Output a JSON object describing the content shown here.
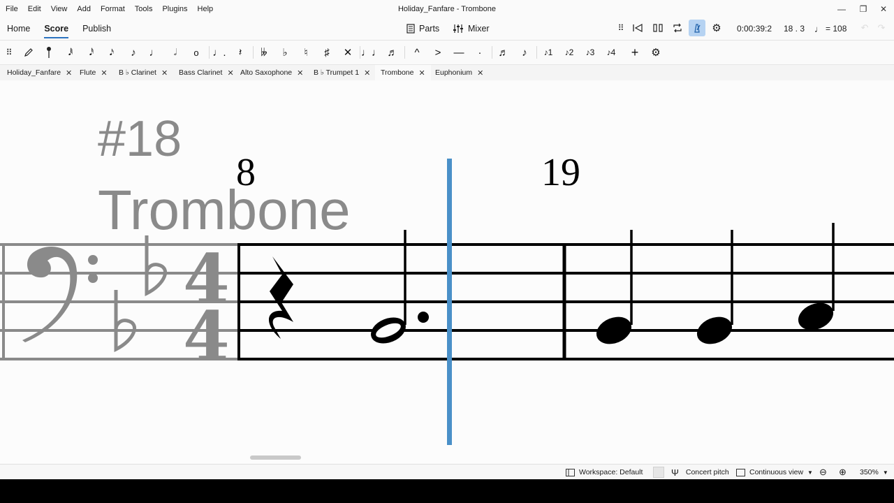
{
  "window": {
    "title": "Holiday_Fanfare - Trombone",
    "menu": [
      "File",
      "Edit",
      "View",
      "Add",
      "Format",
      "Tools",
      "Plugins",
      "Help"
    ],
    "controls": {
      "minimize": "—",
      "restore": "❐",
      "close": "✕"
    }
  },
  "nav": {
    "tabs": [
      "Home",
      "Score",
      "Publish"
    ],
    "active_tab": "Score",
    "parts_label": "Parts",
    "mixer_label": "Mixer"
  },
  "playback": {
    "time": "0:00:39:2",
    "position": "18 . 3",
    "tempo": "= 108",
    "metronome_active": true
  },
  "score_tabs": [
    {
      "label": "Holiday_Fanfare"
    },
    {
      "label": "Flute"
    },
    {
      "label": "B ♭ Clarinet"
    },
    {
      "label": "Bass Clarinet"
    },
    {
      "label": "Alto Saxophone"
    },
    {
      "label": "B ♭ Trumpet 1"
    },
    {
      "label": "Trombone",
      "active": true
    },
    {
      "label": "Euphonium"
    }
  ],
  "score": {
    "rehearsal_mark": "#18",
    "instrument": "Trombone",
    "measure_numbers": [
      "8",
      "19"
    ],
    "clef": "bass-clef",
    "key_signature": "two-flats",
    "time_signature": [
      "4",
      "4"
    ]
  },
  "status": {
    "workspace": "Workspace: Default",
    "concert_pitch": "Concert pitch",
    "view_mode": "Continuous view",
    "zoom": "350%"
  },
  "colors": {
    "accent": "#2b73c0",
    "playhead": "#4a90c8",
    "ghost": "#8a8a8a"
  }
}
